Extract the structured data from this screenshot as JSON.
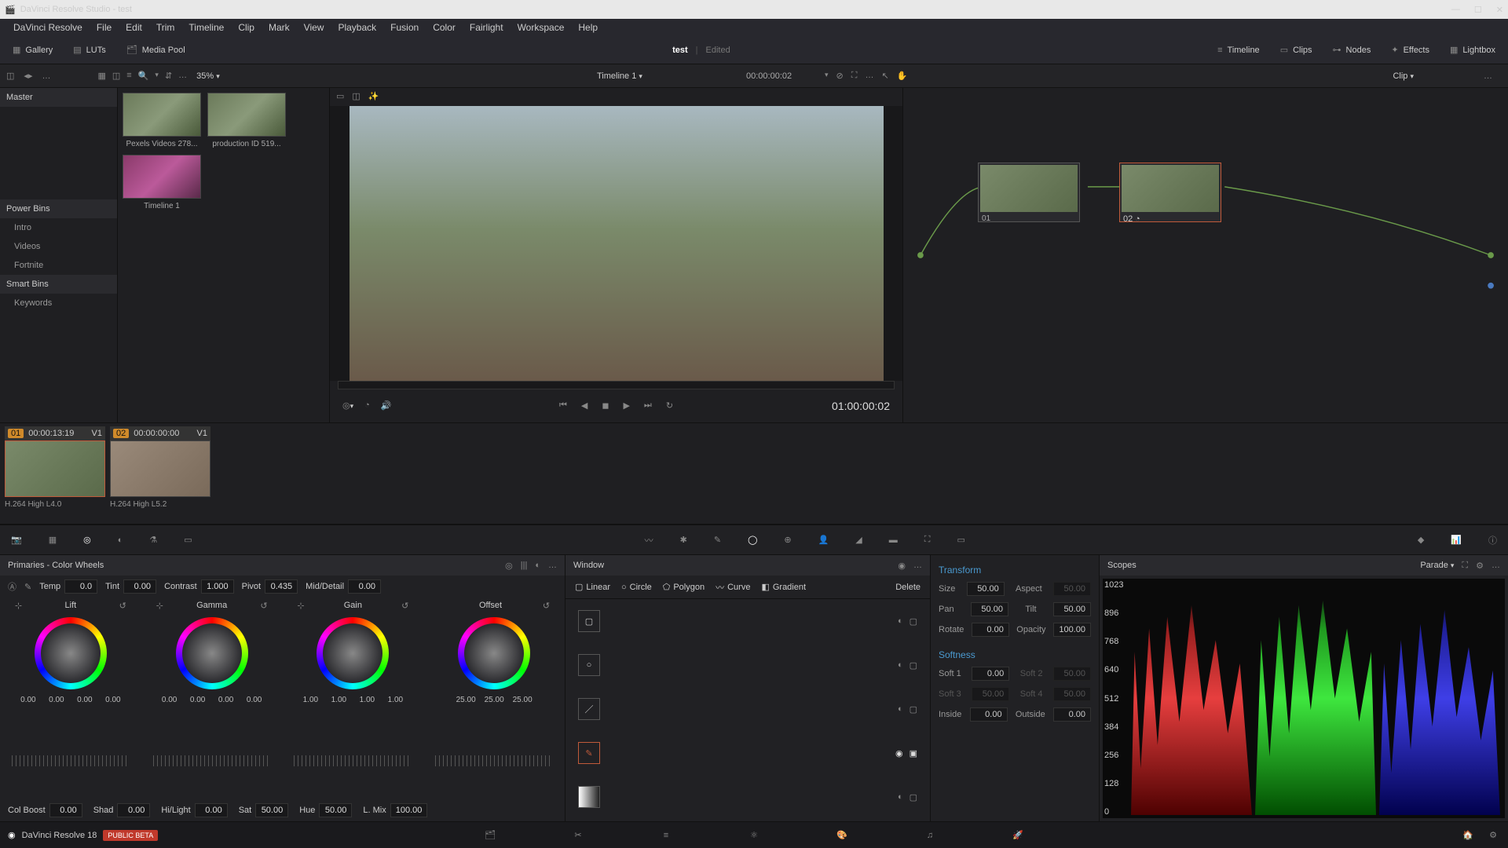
{
  "app": {
    "title": "DaVinci Resolve Studio - test"
  },
  "menu": [
    "DaVinci Resolve",
    "File",
    "Edit",
    "Trim",
    "Timeline",
    "Clip",
    "Mark",
    "View",
    "Playback",
    "Fusion",
    "Color",
    "Fairlight",
    "Workspace",
    "Help"
  ],
  "toolbar": {
    "gallery": "Gallery",
    "luts": "LUTs",
    "mediapool": "Media Pool",
    "project": "test",
    "status": "Edited",
    "timeline": "Timeline",
    "clips": "Clips",
    "nodes": "Nodes",
    "effects": "Effects",
    "lightbox": "Lightbox"
  },
  "subbar": {
    "zoom": "35%",
    "timeline_name": "Timeline 1",
    "tc_header": "00:00:00:02",
    "clip_label": "Clip"
  },
  "sidebar": {
    "master": "Master",
    "powerbins_h": "Power Bins",
    "powerbins": [
      "Intro",
      "Videos",
      "Fortnite"
    ],
    "smartbins_h": "Smart Bins",
    "smartbins": [
      "Keywords"
    ]
  },
  "mediapool": {
    "clip1": "Pexels Videos 278...",
    "clip2": "production ID 519...",
    "clip3": "Timeline 1"
  },
  "transport": {
    "tc": "01:00:00:02"
  },
  "nodes_panel": {
    "n1": "01",
    "n2": "02"
  },
  "strip": {
    "c1_num": "01",
    "c1_tc": "00:00:13:19",
    "c1_track": "V1",
    "c1_codec": "H.264 High L4.0",
    "c2_num": "02",
    "c2_tc": "00:00:00:00",
    "c2_track": "V1",
    "c2_codec": "H.264 High L5.2"
  },
  "primaries": {
    "title": "Primaries - Color Wheels",
    "temp_l": "Temp",
    "temp_v": "0.0",
    "tint_l": "Tint",
    "tint_v": "0.00",
    "contrast_l": "Contrast",
    "contrast_v": "1.000",
    "pivot_l": "Pivot",
    "pivot_v": "0.435",
    "md_l": "Mid/Detail",
    "md_v": "0.00",
    "lift": "Lift",
    "gamma": "Gamma",
    "gain": "Gain",
    "offset": "Offset",
    "lift_vals": [
      "0.00",
      "0.00",
      "0.00",
      "0.00"
    ],
    "gamma_vals": [
      "0.00",
      "0.00",
      "0.00",
      "0.00"
    ],
    "gain_vals": [
      "1.00",
      "1.00",
      "1.00",
      "1.00"
    ],
    "offset_vals": [
      "25.00",
      "25.00",
      "25.00"
    ],
    "colboost_l": "Col Boost",
    "colboost_v": "0.00",
    "shad_l": "Shad",
    "shad_v": "0.00",
    "hilight_l": "Hi/Light",
    "hilight_v": "0.00",
    "sat_l": "Sat",
    "sat_v": "50.00",
    "hue_l": "Hue",
    "hue_v": "50.00",
    "lmix_l": "L. Mix",
    "lmix_v": "100.00"
  },
  "window": {
    "title": "Window",
    "linear": "Linear",
    "circle": "Circle",
    "polygon": "Polygon",
    "curve": "Curve",
    "gradient": "Gradient",
    "delete": "Delete"
  },
  "transform": {
    "title": "Transform",
    "size_l": "Size",
    "size_v": "50.00",
    "aspect_l": "Aspect",
    "aspect_v": "50.00",
    "pan_l": "Pan",
    "pan_v": "50.00",
    "tilt_l": "Tilt",
    "tilt_v": "50.00",
    "rotate_l": "Rotate",
    "rotate_v": "0.00",
    "opacity_l": "Opacity",
    "opacity_v": "100.00",
    "softness_h": "Softness",
    "soft1_l": "Soft 1",
    "soft1_v": "0.00",
    "soft2_l": "Soft 2",
    "soft2_v": "50.00",
    "soft3_l": "Soft 3",
    "soft3_v": "50.00",
    "soft4_l": "Soft 4",
    "soft4_v": "50.00",
    "inside_l": "Inside",
    "inside_v": "0.00",
    "outside_l": "Outside",
    "outside_v": "0.00"
  },
  "scopes": {
    "title": "Scopes",
    "mode": "Parade",
    "labels": [
      "1023",
      "896",
      "768",
      "640",
      "512",
      "384",
      "256",
      "128",
      "0"
    ]
  },
  "pagebar": {
    "app_name": "DaVinci Resolve 18",
    "beta": "PUBLIC BETA"
  }
}
